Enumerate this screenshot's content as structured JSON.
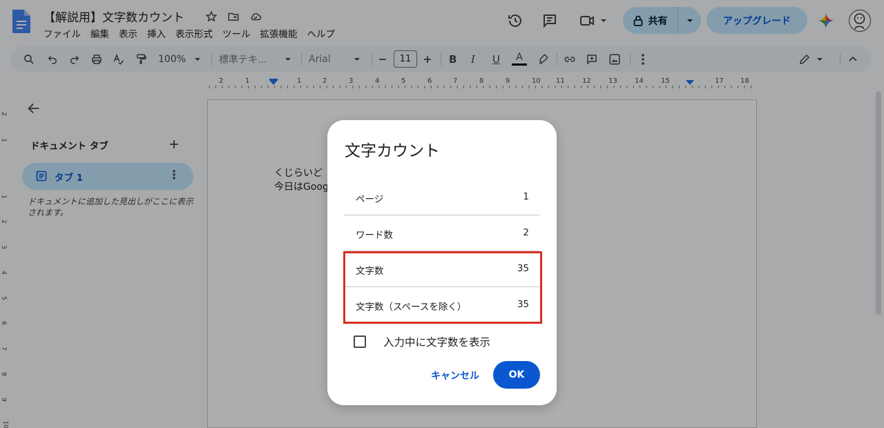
{
  "header": {
    "title": "【解説用】文字数カウント",
    "menu": [
      "ファイル",
      "編集",
      "表示",
      "挿入",
      "表示形式",
      "ツール",
      "拡張機能",
      "ヘルプ"
    ],
    "share_label": "共有",
    "upgrade_label": "アップグレード"
  },
  "toolbar": {
    "zoom": "100%",
    "style": "標準テキ...",
    "font": "Arial",
    "font_size": "11",
    "bold": "B",
    "italic": "I",
    "underline": "U",
    "text_color_letter": "A"
  },
  "ruler": {
    "numbers": [
      "2",
      "1",
      "1",
      "1",
      "2",
      "3",
      "4",
      "5",
      "6",
      "7",
      "8",
      "9",
      "10",
      "11",
      "12",
      "13",
      "14",
      "15",
      "16",
      "17",
      "18"
    ],
    "vnumbers": [
      "2",
      "1",
      "1",
      "2",
      "3",
      "4",
      "5",
      "6",
      "7",
      "8",
      "9",
      "10"
    ]
  },
  "sidebar": {
    "title": "ドキュメント タブ",
    "tab_label": "タブ 1",
    "hint": "ドキュメントに追加した見出しがここに表示されます。"
  },
  "document": {
    "line1": "くじらいど",
    "line2": "今日はGoog"
  },
  "dialog": {
    "title": "文字カウント",
    "rows": [
      {
        "label": "ページ",
        "value": "1"
      },
      {
        "label": "ワード数",
        "value": "2"
      },
      {
        "label": "文字数",
        "value": "35"
      },
      {
        "label": "文字数（スペースを除く）",
        "value": "35"
      }
    ],
    "checkbox_label": "入力中に文字数を表示",
    "checkbox_checked": false,
    "cancel_label": "キャンセル",
    "ok_label": "OK"
  },
  "colors": {
    "accent": "#0b57d0",
    "share_bg": "#c2e7ff",
    "highlight": "#d93025"
  }
}
